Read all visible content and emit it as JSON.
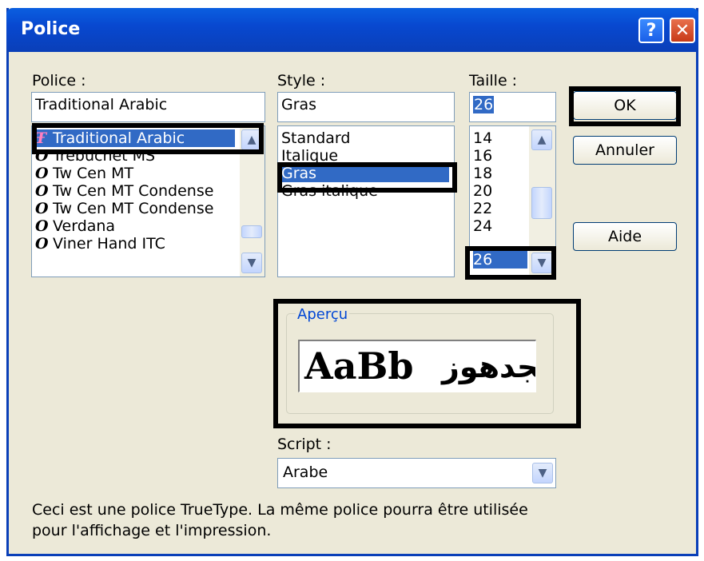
{
  "dialog": {
    "title": "Police",
    "help_glyph": "?",
    "close_glyph": "✕"
  },
  "font": {
    "label": "Police :",
    "value": "Traditional Arabic",
    "items": [
      {
        "icon": "tt-icon",
        "label": "Traditional Arabic",
        "selected": true
      },
      {
        "icon": "opentype-icon",
        "label": "Trebuchet MS"
      },
      {
        "icon": "opentype-icon",
        "label": "Tw Cen MT"
      },
      {
        "icon": "opentype-icon",
        "label": "Tw Cen MT Condense"
      },
      {
        "icon": "opentype-icon",
        "label": "Tw Cen MT Condense"
      },
      {
        "icon": "opentype-icon",
        "label": "Verdana"
      },
      {
        "icon": "opentype-icon",
        "label": "Viner Hand ITC"
      }
    ]
  },
  "style": {
    "label": "Style :",
    "value": "Gras",
    "items": [
      "Standard",
      "Italique",
      "Gras",
      "Gras italique"
    ],
    "selected": "Gras"
  },
  "size": {
    "label": "Taille :",
    "value": "26",
    "items": [
      "14",
      "16",
      "18",
      "20",
      "22",
      "24",
      "26"
    ],
    "selected": "26"
  },
  "buttons": {
    "ok": "OK",
    "cancel": "Annuler",
    "help": "Aide"
  },
  "preview": {
    "label": "Aperçu",
    "latin_text": "AaBb",
    "arabic_text": "بجدهوز"
  },
  "script": {
    "label": "Script :",
    "value": "Arabe"
  },
  "note": {
    "line1": "Ceci est une police TrueType. La même police pourra être utilisée",
    "line2": "pour l'affichage et l'impression."
  },
  "colors": {
    "titlebar": "#0a3fb8",
    "selection": "#316ac5",
    "dialog_bg": "#ece9d8",
    "tt_icon": "#a0166c"
  }
}
